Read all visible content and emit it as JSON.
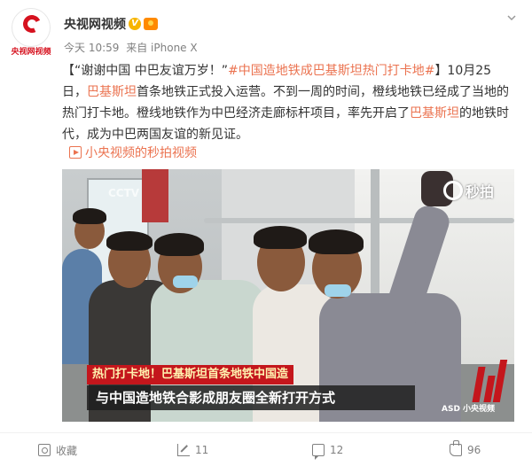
{
  "header": {
    "avatar_label": "央视网视频",
    "author": "央视网视频",
    "verified_mark": "V",
    "time": "今天 10:59",
    "source": "来自 iPhone X"
  },
  "post": {
    "quote_open": "【",
    "quote_text": "“谢谢中国  中巴友谊万岁！”",
    "hashtag": "#中国造地铁成巴基斯坦热门打卡地#",
    "seg1": "】10月25日，",
    "hl1": "巴基斯坦",
    "seg2": "首条地铁正式投入运营。不到一周的时间，橙线地铁已经成了当地的热门打卡地。橙线地铁作为中巴经济走廊标杆项目，率先开启了",
    "hl2": "巴基斯坦",
    "seg3": "的地铁时代，成为中巴两国友谊的新见证。",
    "video_link": "小央视频的秒拍视频"
  },
  "video": {
    "watermark": "秒拍",
    "caption_top": "热门打卡地！巴基斯坦首条地铁中国造",
    "caption_main": "与中国造地铁合影成朋友圈全新打开方式",
    "corner_logo": "ASD 小央视频"
  },
  "actions": {
    "favorite": "收藏",
    "share_count": "11",
    "comment_count": "12",
    "like_count": "96"
  },
  "colors": {
    "accent": "#eb7350",
    "brand_red": "#d6121f",
    "caption_red": "#c4161c"
  }
}
